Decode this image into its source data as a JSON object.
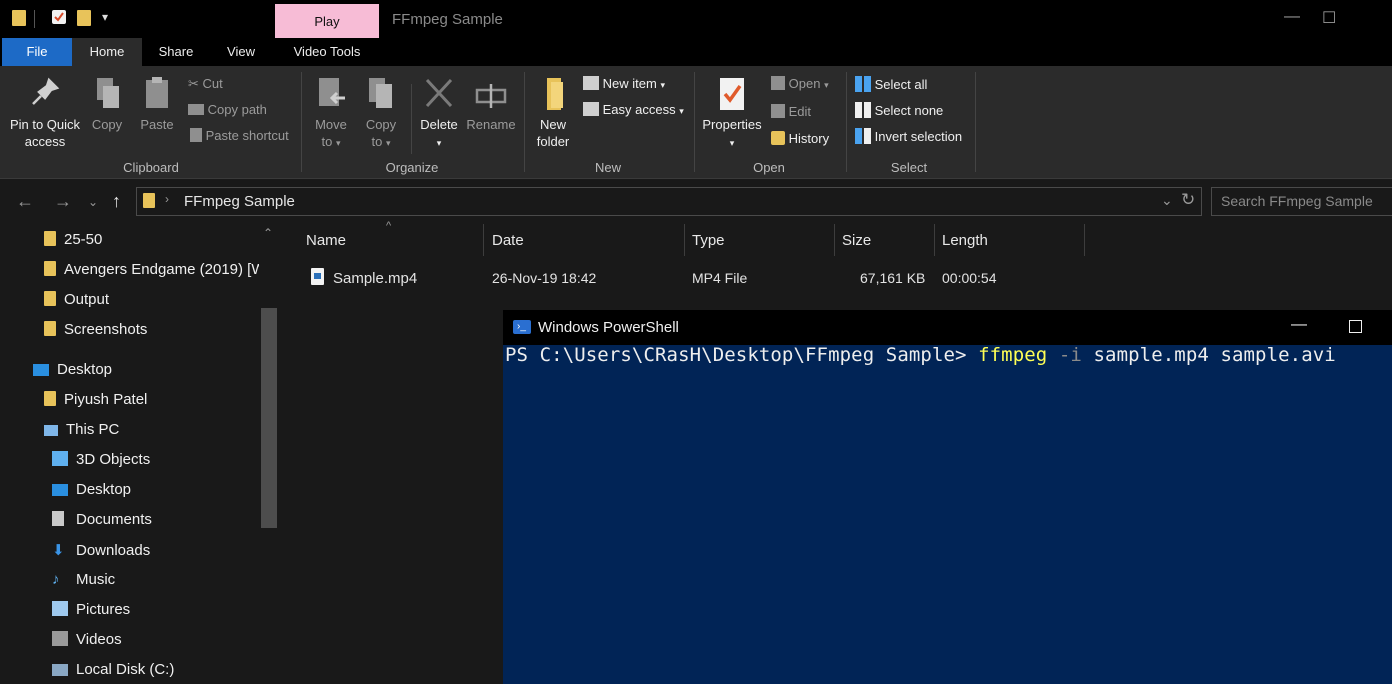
{
  "window": {
    "title": "FFmpeg Sample",
    "contextual_tab": "Play",
    "contextual_tab_color": "#f7bcd6",
    "minimize_glyph": "—",
    "maximize_glyph": "☐"
  },
  "ribbon_tabs": [
    "File",
    "Home",
    "Share",
    "View",
    "Video Tools"
  ],
  "ribbon": {
    "clipboard": {
      "label": "Clipboard",
      "pin_line1": "Pin to Quick",
      "pin_line2": "access",
      "copy": "Copy",
      "paste": "Paste",
      "cut": "Cut",
      "copy_path": "Copy path",
      "paste_shortcut": "Paste shortcut"
    },
    "organize": {
      "label": "Organize",
      "move_line1": "Move",
      "move_line2": "to",
      "copy_line1": "Copy",
      "copy_line2": "to",
      "delete": "Delete",
      "rename": "Rename"
    },
    "new": {
      "label": "New",
      "new_folder_line1": "New",
      "new_folder_line2": "folder",
      "new_item": "New item",
      "easy_access": "Easy access"
    },
    "open": {
      "label": "Open",
      "properties": "Properties",
      "open": "Open",
      "edit": "Edit",
      "history": "History"
    },
    "select": {
      "label": "Select",
      "select_all": "Select all",
      "select_none": "Select none",
      "invert_selection": "Invert selection"
    }
  },
  "address": {
    "path": "FFmpeg Sample",
    "search_placeholder": "Search FFmpeg Sample"
  },
  "nav": {
    "quick_items": [
      "25-50",
      "Avengers Endgame (2019) [W",
      "Output",
      "Screenshots"
    ],
    "desktop": "Desktop",
    "user": "Piyush Patel",
    "this_pc": "This PC",
    "pc_items": [
      "3D Objects",
      "Desktop",
      "Documents",
      "Downloads",
      "Music",
      "Pictures",
      "Videos",
      "Local Disk (C:)"
    ]
  },
  "columns": [
    "Name",
    "Date",
    "Type",
    "Size",
    "Length"
  ],
  "files": [
    {
      "name": "Sample.mp4",
      "date": "26-Nov-19 18:42",
      "type": "MP4 File",
      "size": "67,161 KB",
      "length": "00:00:54"
    }
  ],
  "powershell": {
    "title": "Windows PowerShell",
    "prompt": "PS C:\\Users\\CRasH\\Desktop\\FFmpeg Sample> ",
    "command": "ffmpeg",
    "flag": "-i",
    "args": "sample.mp4 sample.avi",
    "bg_color": "#012456",
    "command_color": "#ffff55",
    "flag_color": "#8a8a8a"
  }
}
